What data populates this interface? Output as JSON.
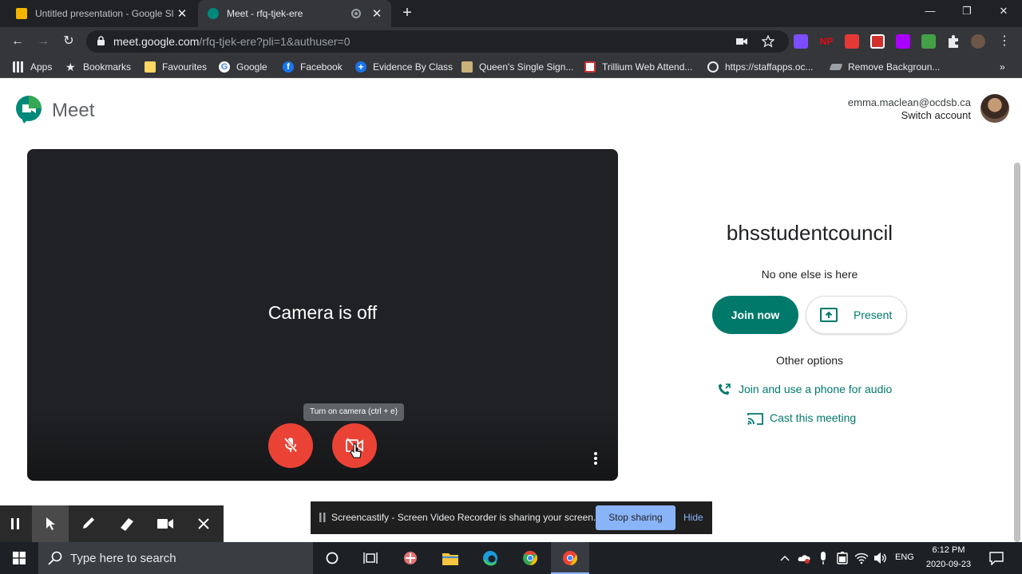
{
  "browser": {
    "tabs": [
      {
        "title": "Untitled presentation - Google Sl",
        "active": false,
        "favicon_color": "#f4b400"
      },
      {
        "title": "Meet - rfq-tjek-ere",
        "active": true,
        "favicon_color": "#00897b"
      }
    ],
    "url_host": "meet.google.com",
    "url_path": "/rfq-tjek-ere?pli=1&authuser=0",
    "bookmarks": [
      {
        "label": "Apps",
        "icon": "apps-grid-icon"
      },
      {
        "label": "Bookmarks",
        "icon": "star-icon"
      },
      {
        "label": "Favourites",
        "icon": "folder-icon"
      },
      {
        "label": "Google",
        "icon": "google-icon"
      },
      {
        "label": "Facebook",
        "icon": "facebook-icon"
      },
      {
        "label": "Evidence By Class",
        "icon": "plus-circle-icon"
      },
      {
        "label": "Queen's Single Sign...",
        "icon": "queens-icon"
      },
      {
        "label": "Trillium Web Attend...",
        "icon": "trillium-icon"
      },
      {
        "label": "https://staffapps.oc...",
        "icon": "globe-icon"
      },
      {
        "label": "Remove Backgroun...",
        "icon": "remove-bg-icon"
      }
    ],
    "bookmarks_overflow": "»"
  },
  "meet": {
    "brand": "Meet",
    "account_email": "emma.maclean@ocdsb.ca",
    "switch_account": "Switch account",
    "camera_status": "Camera is off",
    "camera_tooltip": "Turn on camera (ctrl + e)",
    "meeting_name": "bhsstudentcouncil",
    "participants_status": "No one else is here",
    "join_button": "Join now",
    "present_button": "Present",
    "other_options": "Other options",
    "phone_audio_link": "Join and use a phone for audio",
    "cast_link": "Cast this meeting",
    "accent_color": "#00796b",
    "mute_button_color": "#ea4335"
  },
  "screencastify": {
    "banner_text": "Screencastify - Screen Video Recorder is sharing your screen.",
    "stop_sharing": "Stop sharing",
    "hide": "Hide"
  },
  "taskbar": {
    "search_placeholder": "Type here to search",
    "language": "ENG",
    "time": "6:12 PM",
    "date": "2020-09-23"
  }
}
